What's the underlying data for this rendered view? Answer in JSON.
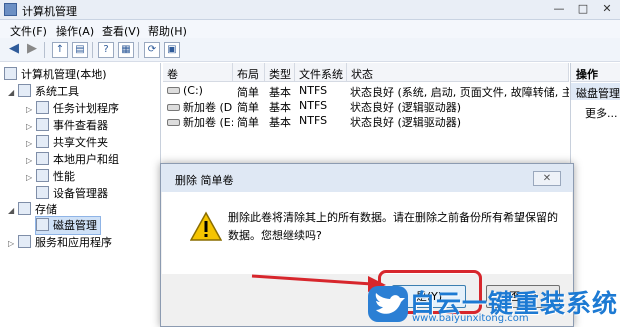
{
  "window": {
    "title": "计算机管理"
  },
  "menu": {
    "items": [
      {
        "label": "文件(F)"
      },
      {
        "label": "操作(A)"
      },
      {
        "label": "查看(V)"
      },
      {
        "label": "帮助(H)"
      }
    ]
  },
  "tree": {
    "root": "计算机管理(本地)",
    "items": [
      {
        "label": "系统工具"
      },
      {
        "label": "任务计划程序"
      },
      {
        "label": "事件查看器"
      },
      {
        "label": "共享文件夹"
      },
      {
        "label": "本地用户和组"
      },
      {
        "label": "性能"
      },
      {
        "label": "设备管理器"
      },
      {
        "label": "存储"
      },
      {
        "label": "磁盘管理"
      },
      {
        "label": "服务和应用程序"
      }
    ]
  },
  "volumes": {
    "columns": [
      "卷",
      "布局",
      "类型",
      "文件系统",
      "状态"
    ],
    "rows": [
      {
        "volume": "(C:)",
        "layout": "简单",
        "type": "基本",
        "fs": "NTFS",
        "status": "状态良好 (系统, 启动, 页面文件, 故障转储, 主分区)"
      },
      {
        "volume": "新加卷 (D:)",
        "layout": "简单",
        "type": "基本",
        "fs": "NTFS",
        "status": "状态良好 (逻辑驱动器)"
      },
      {
        "volume": "新加卷 (E:)",
        "layout": "简单",
        "type": "基本",
        "fs": "NTFS",
        "status": "状态良好 (逻辑驱动器)"
      }
    ]
  },
  "actions": {
    "header": "操作",
    "section": "磁盘管理",
    "more": "更多..."
  },
  "dialog": {
    "title": "删除 简单卷",
    "message": "删除此卷将清除其上的所有数据。请在删除之前备份所有希望保留的数据。您想继续吗?",
    "yes": "是(Y)",
    "no": "否(N)"
  },
  "watermark": {
    "title": "白云一键重装系统",
    "url": "www.baiyunxitong.com"
  },
  "colors": {
    "highlight": "#d7262c",
    "watermark": "#1d7ad3"
  }
}
